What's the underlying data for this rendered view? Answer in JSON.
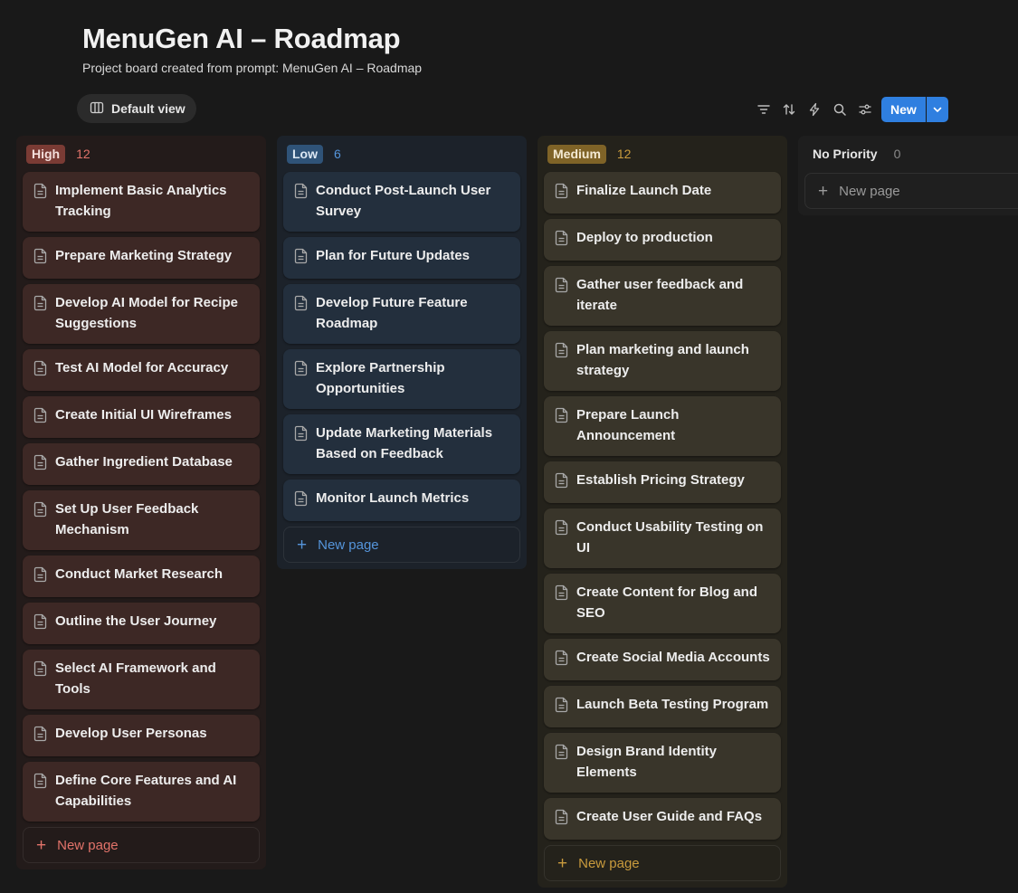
{
  "header": {
    "title": "MenuGen AI – Roadmap",
    "subtitle": "Project board created from prompt: MenuGen AI – Roadmap"
  },
  "view": {
    "label": "Default view",
    "icon": "board-view-icon"
  },
  "toolbar": {
    "icons": [
      "filter-icon",
      "sort-icon",
      "automation-icon",
      "search-icon",
      "settings-icon"
    ],
    "new_label": "New"
  },
  "new_page_label": "New page",
  "columns": [
    {
      "name": "High",
      "count": "12",
      "accent": "#e2736a",
      "cards": [
        "Implement Basic Analytics Tracking",
        "Prepare Marketing Strategy",
        "Develop AI Model for Recipe Suggestions",
        "Test AI Model for Accuracy",
        "Create Initial UI Wireframes",
        "Gather Ingredient Database",
        "Set Up User Feedback Mechanism",
        "Conduct Market Research",
        "Outline the User Journey",
        "Select AI Framework and Tools",
        "Develop User Personas",
        "Define Core Features and AI Capabilities"
      ]
    },
    {
      "name": "Low",
      "count": "6",
      "accent": "#5595db",
      "cards": [
        "Conduct Post-Launch User Survey",
        "Plan for Future Updates",
        "Develop Future Feature Roadmap",
        "Explore Partnership Opportunities",
        "Update Marketing Materials Based on Feedback",
        "Monitor Launch Metrics"
      ]
    },
    {
      "name": "Medium",
      "count": "12",
      "accent": "#c99b3d",
      "cards": [
        "Finalize Launch Date",
        "Deploy to production",
        "Gather user feedback and iterate",
        "Plan marketing and launch strategy",
        "Prepare Launch Announcement",
        "Establish Pricing Strategy",
        "Conduct Usability Testing on UI",
        "Create Content for Blog and SEO",
        "Create Social Media Accounts",
        "Launch Beta Testing Program",
        "Design Brand Identity Elements",
        "Create User Guide and FAQs"
      ]
    },
    {
      "name": "No Priority",
      "count": "0",
      "accent": "#8a8a8a",
      "cards": []
    }
  ]
}
